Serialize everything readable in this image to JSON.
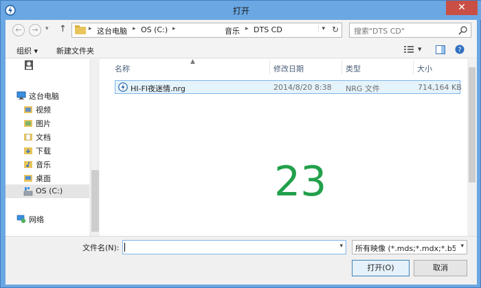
{
  "window": {
    "title": "打开"
  },
  "address": {
    "crumbs": [
      "这台电脑",
      "OS (C:)",
      "音乐",
      "DTS CD"
    ]
  },
  "search": {
    "placeholder": "搜索\"DTS CD\""
  },
  "toolbar": {
    "organize": "组织",
    "new_folder": "新建文件夹"
  },
  "sidebar": {
    "items": [
      {
        "label": "这台电脑",
        "icon": "computer-icon"
      },
      {
        "label": "视频",
        "icon": "folder-icon"
      },
      {
        "label": "图片",
        "icon": "folder-icon"
      },
      {
        "label": "文档",
        "icon": "folder-icon"
      },
      {
        "label": "下载",
        "icon": "folder-icon"
      },
      {
        "label": "音乐",
        "icon": "folder-icon"
      },
      {
        "label": "桌面",
        "icon": "folder-icon"
      },
      {
        "label": "OS (C:)",
        "icon": "drive-icon"
      },
      {
        "label": "网络",
        "icon": "network-icon"
      }
    ]
  },
  "columns": {
    "name": "名称",
    "modified": "修改日期",
    "type": "类型",
    "size": "大小"
  },
  "files": [
    {
      "name": "HI-FI夜迷情.nrg",
      "modified": "2014/8/20 8:38",
      "type": "NRG 文件",
      "size": "714,164 KB"
    }
  ],
  "overlay_number": "23",
  "bottom": {
    "filename_label": "文件名(N):",
    "filename_value": "",
    "filter": "所有映像 (*.mds;*.mdx;*.b5t;*",
    "open": "打开(O)",
    "cancel": "取消"
  },
  "colors": {
    "accent": "#6aa7e3",
    "selection": "#e5f3fb",
    "overlay": "#22a04b",
    "close": "#c94f45"
  }
}
